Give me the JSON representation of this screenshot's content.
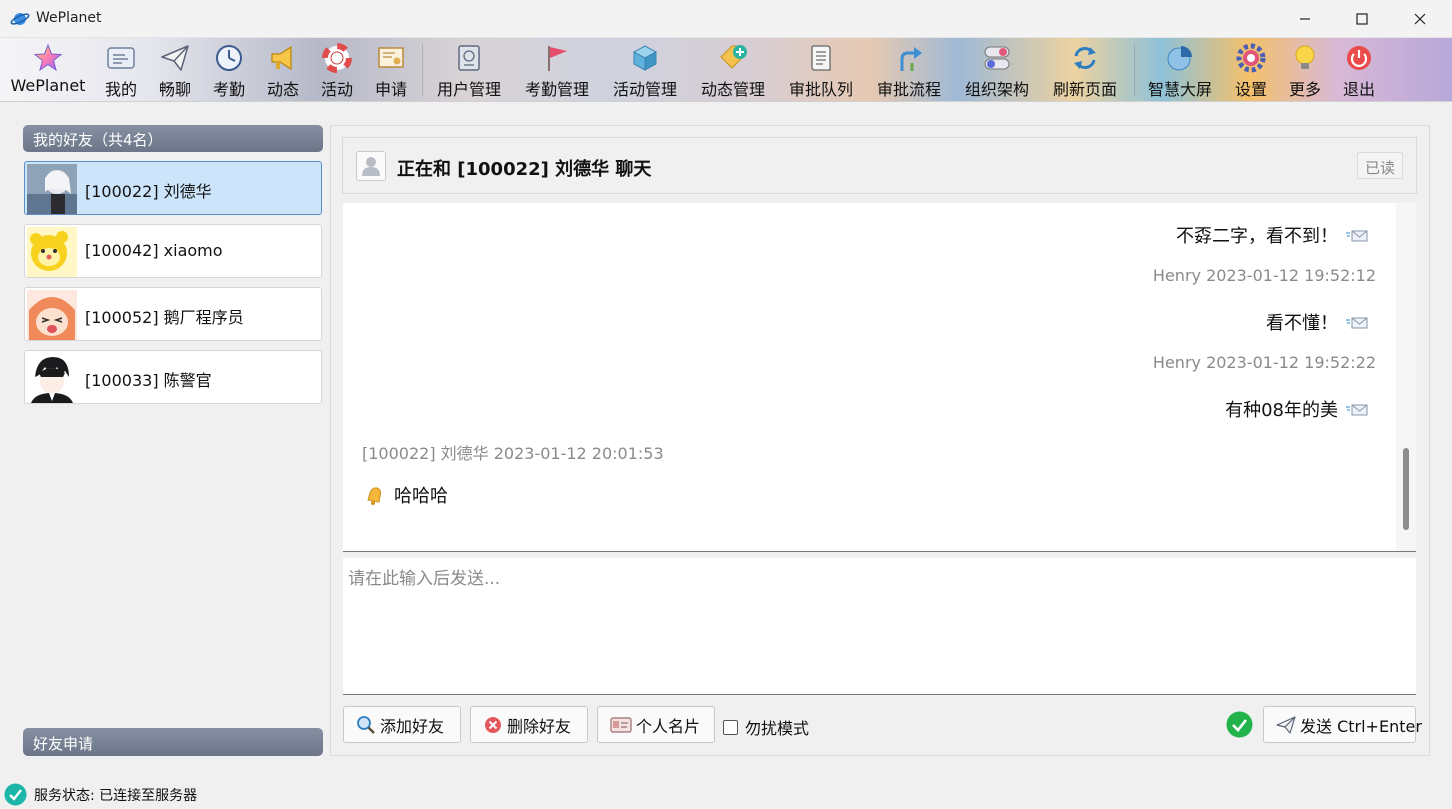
{
  "window": {
    "title": "WePlanet"
  },
  "toolbar": {
    "items": [
      {
        "label": "WePlanet",
        "icon": "star-icon"
      },
      {
        "label": "我的",
        "icon": "id-card-icon"
      },
      {
        "label": "畅聊",
        "icon": "paper-plane-icon"
      },
      {
        "label": "考勤",
        "icon": "clock-icon"
      },
      {
        "label": "动态",
        "icon": "megaphone-icon"
      },
      {
        "label": "活动",
        "icon": "lifebuoy-icon"
      },
      {
        "label": "申请",
        "icon": "certificate-icon"
      },
      {
        "label": "用户管理",
        "icon": "passport-icon"
      },
      {
        "label": "考勤管理",
        "icon": "flag-icon"
      },
      {
        "label": "活动管理",
        "icon": "cube-icon"
      },
      {
        "label": "动态管理",
        "icon": "tag-add-icon"
      },
      {
        "label": "审批队列",
        "icon": "document-list-icon"
      },
      {
        "label": "审批流程",
        "icon": "route-arrow-icon"
      },
      {
        "label": "组织架构",
        "icon": "toggle-switches-icon"
      },
      {
        "label": "刷新页面",
        "icon": "refresh-icon"
      },
      {
        "label": "智慧大屏",
        "icon": "pie-chart-icon"
      },
      {
        "label": "设置",
        "icon": "gear-icon"
      },
      {
        "label": "更多",
        "icon": "lightbulb-icon"
      },
      {
        "label": "退出",
        "icon": "power-icon"
      }
    ]
  },
  "friends": {
    "header": "我的好友（共4名）",
    "list": [
      {
        "name": "[100022] 刘德华",
        "selected": true
      },
      {
        "name": "[100042] xiaomo",
        "selected": false
      },
      {
        "name": "[100052] 鹅厂程序员",
        "selected": false
      },
      {
        "name": "[100033] 陈警官",
        "selected": false
      }
    ],
    "requests_header": "好友申请"
  },
  "chat": {
    "title": "正在和 [100022] 刘德华 聊天",
    "read_status": "已读",
    "messages": [
      {
        "side": "right",
        "text": "不孬二字，看不到！"
      },
      {
        "side": "right",
        "meta": "Henry 2023-01-12 19:52:12",
        "text": "看不懂！"
      },
      {
        "side": "right",
        "meta": "Henry 2023-01-12 19:52:22",
        "text": "有种08年的美"
      },
      {
        "side": "left",
        "meta": "[100022] 刘德华 2023-01-12 20:01:53",
        "text": "哈哈哈"
      }
    ],
    "input_placeholder": "请在此输入后发送...",
    "buttons": {
      "add_friend": "添加好友",
      "delete_friend": "删除好友",
      "profile_card": "个人名片",
      "dnd_mode": "勿扰模式",
      "send": "发送 Ctrl+Enter"
    }
  },
  "status": {
    "text": "服务状态: 已连接至服务器"
  },
  "colors": {
    "accent": "#5a8fc8",
    "selected_bg": "#cde5fa",
    "header_bg": "#7a8497",
    "online": "#22b34a"
  }
}
